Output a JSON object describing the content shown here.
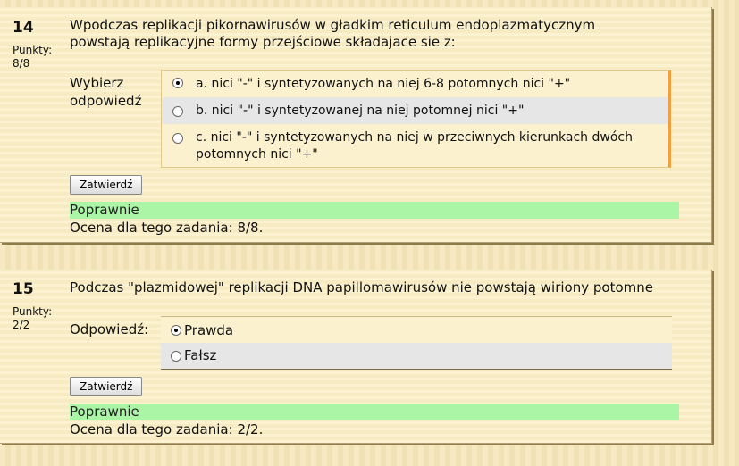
{
  "questions": [
    {
      "number": "14",
      "points_label": "Punkty:",
      "points": "8/8",
      "text": "Wpodczas replikacji pikornawirusów w gładkim reticulum endoplazmatycznym powstają replikacyjne formy przejściowe składajace sie z:",
      "answer_label": "Wybierz odpowiedź",
      "choices": [
        {
          "label": "a. nici \"-\" i syntetyzowanych na niej 6-8 potomnych nici \"+\"",
          "selected": true
        },
        {
          "label": "b. nici \"-\" i syntetyzowanej na niej potomnej nici \"+\"",
          "selected": false
        },
        {
          "label": "c. nici \"-\" i syntetyzowanych na niej w przeciwnych kierunkach dwóch potomnych nici \"+\"",
          "selected": false
        }
      ],
      "submit_label": "Zatwierdź",
      "feedback": "Poprawnie",
      "grade": "Ocena dla tego zadania: 8/8."
    },
    {
      "number": "15",
      "points_label": "Punkty:",
      "points": "2/2",
      "text": "Podczas \"plazmidowej\" replikacji DNA papillomawirusów nie powstają wiriony potomne",
      "answer_label": "Odpowiedź:",
      "choices": [
        {
          "label": "Prawda",
          "selected": true
        },
        {
          "label": "Fałsz",
          "selected": false
        }
      ],
      "submit_label": "Zatwierdź",
      "feedback": "Poprawnie",
      "grade": "Ocena dla tego zadania: 2/2."
    }
  ],
  "colors": {
    "background": "#f6e7b9",
    "card": "#fbefc6",
    "feedback_bg": "#aaf5a6",
    "choice_alt_bg": "#e6e6e6",
    "choice_border_accent": "#f0a040"
  }
}
